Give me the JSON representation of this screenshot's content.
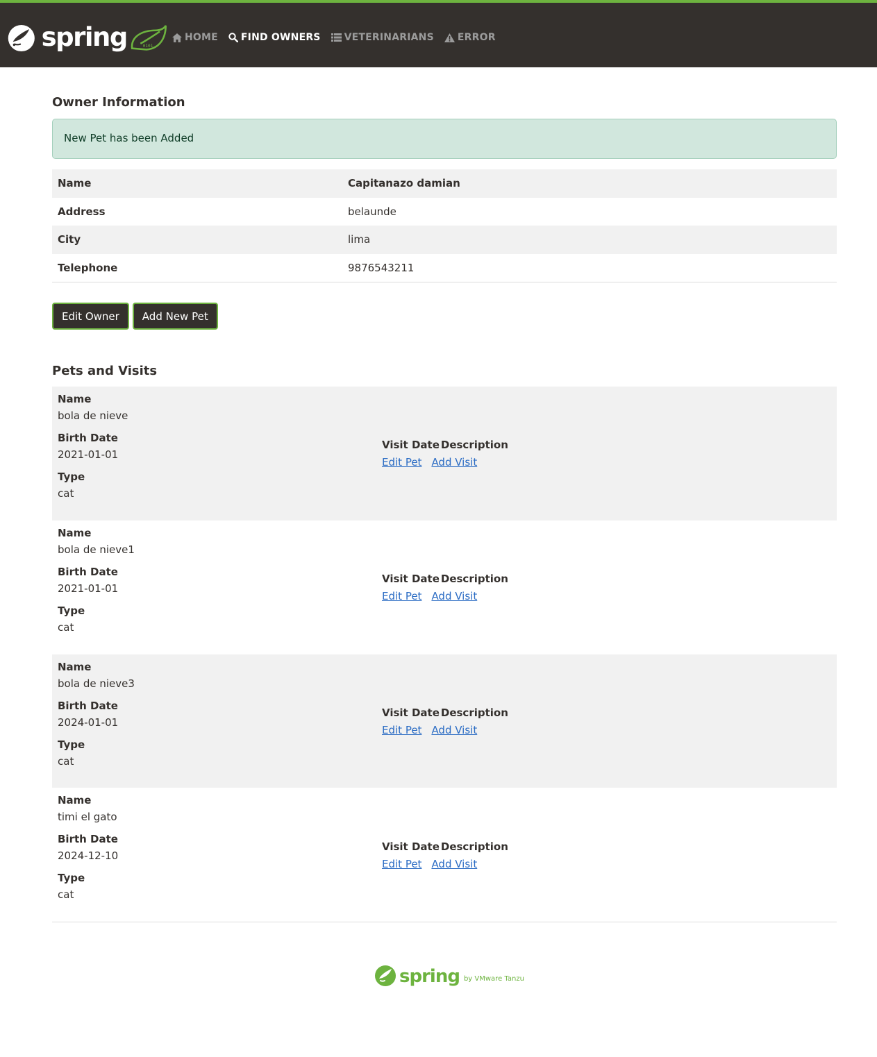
{
  "brand": {
    "name": "spring",
    "accent_color": "#6db33f",
    "bar_color": "#34302d"
  },
  "nav": {
    "items": [
      {
        "label": "HOME",
        "icon": "home-icon",
        "active": false
      },
      {
        "label": "FIND OWNERS",
        "icon": "search-icon",
        "active": true
      },
      {
        "label": "VETERINARIANS",
        "icon": "list-icon",
        "active": false
      },
      {
        "label": "ERROR",
        "icon": "warning-icon",
        "active": false
      }
    ]
  },
  "owner": {
    "heading": "Owner Information",
    "alert": "New Pet has been Added",
    "fields": [
      {
        "label": "Name",
        "value": "Capitanazo damian"
      },
      {
        "label": "Address",
        "value": "belaunde"
      },
      {
        "label": "City",
        "value": "lima"
      },
      {
        "label": "Telephone",
        "value": "9876543211"
      }
    ],
    "edit_button": "Edit Owner",
    "add_pet_button": "Add New Pet"
  },
  "pets": {
    "heading": "Pets and Visits",
    "labels": {
      "name": "Name",
      "birth_date": "Birth Date",
      "type": "Type",
      "visit_date": "Visit Date",
      "description": "Description",
      "edit_pet": "Edit Pet",
      "add_visit": "Add Visit"
    },
    "items": [
      {
        "name": "bola de nieve",
        "birth_date": "2021-01-01",
        "type": "cat"
      },
      {
        "name": "bola de nieve1",
        "birth_date": "2021-01-01",
        "type": "cat"
      },
      {
        "name": "bola de nieve3",
        "birth_date": "2024-01-01",
        "type": "cat"
      },
      {
        "name": "timi el gato",
        "birth_date": "2024-12-10",
        "type": "cat"
      }
    ]
  },
  "footer": {
    "name": "spring",
    "by": "by VMware Tanzu"
  }
}
